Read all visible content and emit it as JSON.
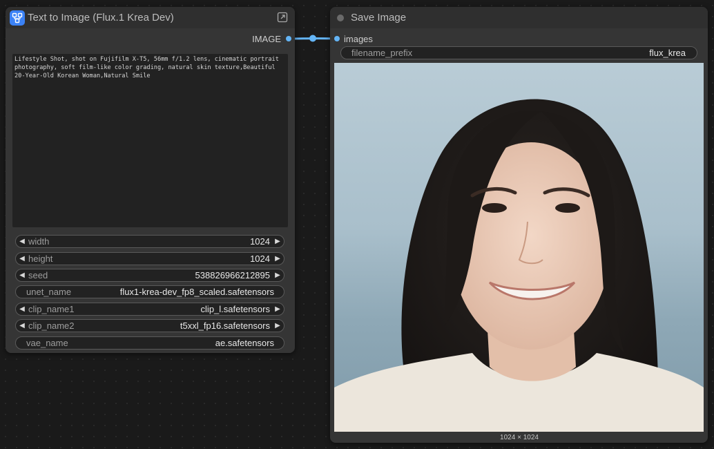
{
  "text_node": {
    "title": "Text to Image (Flux.1 Krea Dev)",
    "output_label": "IMAGE",
    "prompt": "Lifestyle Shot, shot on Fujifilm X-T5, 56mm f/1.2 lens, cinematic portrait photography, soft film-like color grading, natural skin texture,Beautiful 20-Year-Old Korean Woman,Natural Smile",
    "widgets": [
      {
        "label": "width",
        "value": "1024"
      },
      {
        "label": "height",
        "value": "1024"
      },
      {
        "label": "seed",
        "value": "538826966212895"
      },
      {
        "label": "unet_name",
        "value": "flux1-krea-dev_fp8_scaled.safetensors"
      },
      {
        "label": "clip_name1",
        "value": "clip_l.safetensors"
      },
      {
        "label": "clip_name2",
        "value": "t5xxl_fp16.safetensors"
      },
      {
        "label": "vae_name",
        "value": "ae.safetensors"
      }
    ],
    "arrow_left": "◀",
    "arrow_right": "▶"
  },
  "save_node": {
    "title": "Save Image",
    "input_label": "images",
    "filename_prefix": {
      "label": "filename_prefix",
      "value": "flux_krea"
    },
    "image_size": "1024 × 1024"
  },
  "colors": {
    "link": "#64b5f6",
    "subgraph_badge": "#3b82f6"
  }
}
